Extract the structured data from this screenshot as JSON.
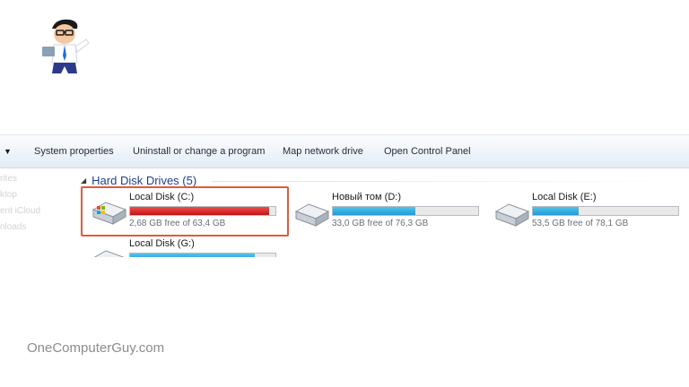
{
  "toolbar": {
    "dropdown_glyph": "▼",
    "items": [
      "System properties",
      "Uninstall or change a program",
      "Map network drive",
      "Open Control Panel"
    ]
  },
  "nav_pane": {
    "items": [
      "rites",
      "ktop",
      "ent iCloud",
      "nloads"
    ]
  },
  "section": {
    "arrow_glyph": "◢",
    "title": "Hard Disk Drives (5)"
  },
  "drives": [
    {
      "name": "Local Disk (C:)",
      "free_text": "2,68 GB free of 63,4 GB",
      "used_fraction": 0.958,
      "bar_status": "critical",
      "icon": "windows-drive-icon"
    },
    {
      "name": "Новый том (D:)",
      "free_text": "33,0 GB free of 76,3 GB",
      "used_fraction": 0.567,
      "bar_status": "normal",
      "icon": "hard-drive-icon"
    },
    {
      "name": "Local Disk (E:)",
      "free_text": "53,5 GB free of 78,1 GB",
      "used_fraction": 0.315,
      "bar_status": "normal",
      "icon": "hard-drive-icon"
    },
    {
      "name": "Local Disk (G:)",
      "used_fraction": 0.86,
      "bar_status": "normal",
      "icon": "hard-drive-icon"
    }
  ],
  "colors": {
    "critical_bar": "#d0191a",
    "normal_bar": "#26a0da",
    "highlight_box": "#e25a3a",
    "section_title": "#1f3f8c"
  },
  "watermark": "OneComputerGuy.com"
}
